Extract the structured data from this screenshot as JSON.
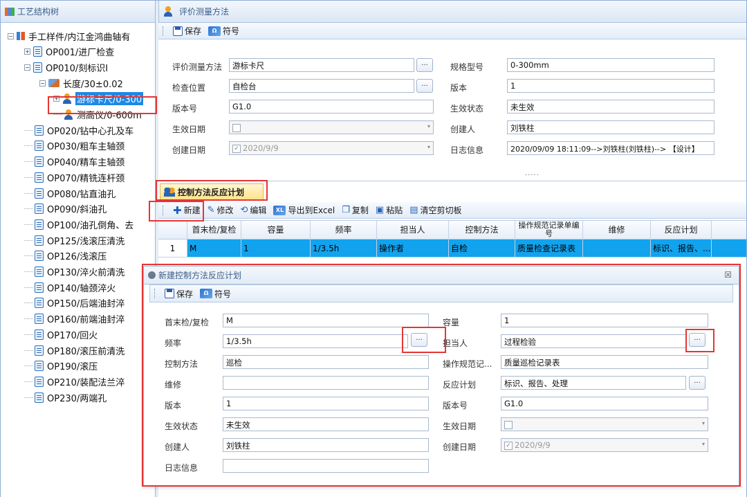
{
  "left_panel": {
    "title": "工艺结构树",
    "tree": [
      {
        "label": "手工样件/内江金鸿曲轴有",
        "icon": "tree-root-icon"
      },
      {
        "label": "OP001/进厂检查"
      },
      {
        "label": "OP010/刻标识Ⅰ"
      },
      {
        "label": "长度/30±0.02"
      },
      {
        "label": "游标卡尺/0-300"
      },
      {
        "label": "测高仪/0-600m"
      },
      {
        "label": "OP020/钻中心孔及车"
      },
      {
        "label": "OP030/粗车主轴颈"
      },
      {
        "label": "OP040/精车主轴颈"
      },
      {
        "label": "OP070/精铣连杆颈"
      },
      {
        "label": "OP080/钻直油孔"
      },
      {
        "label": "OP090/斜油孔"
      },
      {
        "label": "OP100/油孔倒角、去"
      },
      {
        "label": "OP125/浅滚压清洗"
      },
      {
        "label": "OP126/浅滚压"
      },
      {
        "label": "OP130/淬火前清洗"
      },
      {
        "label": "OP140/轴颈淬火"
      },
      {
        "label": "OP150/后端油封淬"
      },
      {
        "label": "OP160/前端油封淬"
      },
      {
        "label": "OP170/回火"
      },
      {
        "label": "OP180/滚压前清洗"
      },
      {
        "label": "OP190/滚压"
      },
      {
        "label": "OP210/装配法兰淬"
      },
      {
        "label": "OP230/两端孔"
      }
    ]
  },
  "eval_panel": {
    "title": "评价测量方法",
    "toolbar": {
      "save": "保存",
      "symbol": "符号"
    },
    "fields": {
      "method_label": "评价测量方法",
      "method_value": "游标卡尺",
      "spec_label": "规格型号",
      "spec_value": "0-300mm",
      "location_label": "检查位置",
      "location_value": "自检台",
      "version_label": "版本",
      "version_value": "1",
      "version_no_label": "版本号",
      "version_no_value": "G1.0",
      "status_label": "生效状态",
      "status_value": "未生效",
      "eff_date_label": "生效日期",
      "eff_date_value": "",
      "creator_label": "创建人",
      "creator_value": "刘铁柱",
      "create_date_label": "创建日期",
      "create_date_value": "2020/9/9",
      "log_label": "日志信息",
      "log_value": "2020/09/09 18:11:09-->刘铁柱(刘铁柱)--> 【设计】"
    },
    "splitter": "....."
  },
  "control_panel": {
    "tab_label": "控制方法反应计划",
    "toolbar": {
      "new": "新建",
      "edit_mod": "修改",
      "edit": "编辑",
      "export": "导出到Excel",
      "copy": "复制",
      "paste": "粘贴",
      "clear": "清空剪切板"
    },
    "columns": [
      "首末检/复检",
      "容量",
      "频率",
      "担当人",
      "控制方法",
      "操作规范记录单编号",
      "维修",
      "反应计划"
    ],
    "rows": [
      {
        "index": "1",
        "cells": [
          "M",
          "1",
          "1/3.5h",
          "操作者",
          "自检",
          "质量检查记录表",
          "",
          "标识、报告、..."
        ]
      }
    ]
  },
  "dialog": {
    "title": "新建控制方法反应计划",
    "close": "☒",
    "toolbar": {
      "save": "保存",
      "symbol": "符号"
    },
    "fields": {
      "inspect_label": "首末检/复检",
      "inspect_value": "M",
      "capacity_label": "容量",
      "capacity_value": "1",
      "freq_label": "频率",
      "freq_value": "1/3.5h",
      "owner_label": "担当人",
      "owner_value": "过程检验",
      "ctrl_label": "控制方法",
      "ctrl_value": "巡检",
      "record_label": "操作规范记...",
      "record_value": "质量巡检记录表",
      "repair_label": "维修",
      "repair_value": "",
      "reaction_label": "反应计划",
      "reaction_value": "标识、报告、处理",
      "version_label": "版本",
      "version_value": "1",
      "version_no_label": "版本号",
      "version_no_value": "G1.0",
      "status_label": "生效状态",
      "status_value": "未生效",
      "eff_date_label": "生效日期",
      "eff_date_value": "",
      "creator_label": "创建人",
      "creator_value": "刘铁柱",
      "create_date_label": "创建日期",
      "create_date_value": "2020/9/9",
      "log_label": "日志信息",
      "log_value": ""
    }
  },
  "colors": {
    "highlight": "#e53535",
    "selection": "#00a0e9",
    "accent": "#2f5aa8"
  }
}
